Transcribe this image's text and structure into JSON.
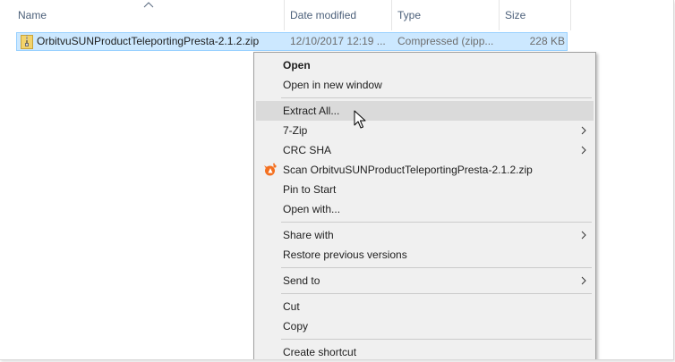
{
  "columns": {
    "name": "Name",
    "date_modified": "Date modified",
    "type": "Type",
    "size": "Size"
  },
  "file": {
    "name": "OrbitvuSUNProductTeleportingPresta-2.1.2.zip",
    "date_modified": "12/10/2017 12:19 ...",
    "type": "Compressed (zipp...",
    "size": "228 KB"
  },
  "menu": {
    "open": "Open",
    "open_new_window": "Open in new window",
    "extract_all": "Extract All...",
    "seven_zip": "7-Zip",
    "crc_sha": "CRC SHA",
    "scan": "Scan OrbitvuSUNProductTeleportingPresta-2.1.2.zip",
    "pin_to_start": "Pin to Start",
    "open_with": "Open with...",
    "share_with": "Share with",
    "restore_previous": "Restore previous versions",
    "send_to": "Send to",
    "cut": "Cut",
    "copy": "Copy",
    "create_shortcut": "Create shortcut"
  },
  "colors": {
    "selection_fill": "#cce8ff",
    "selection_border": "#99d1ff",
    "menu_hover": "#dadada",
    "avast_orange": "#f47020"
  },
  "icons": {
    "file": "zip-archive-icon",
    "scan": "avast-icon"
  }
}
